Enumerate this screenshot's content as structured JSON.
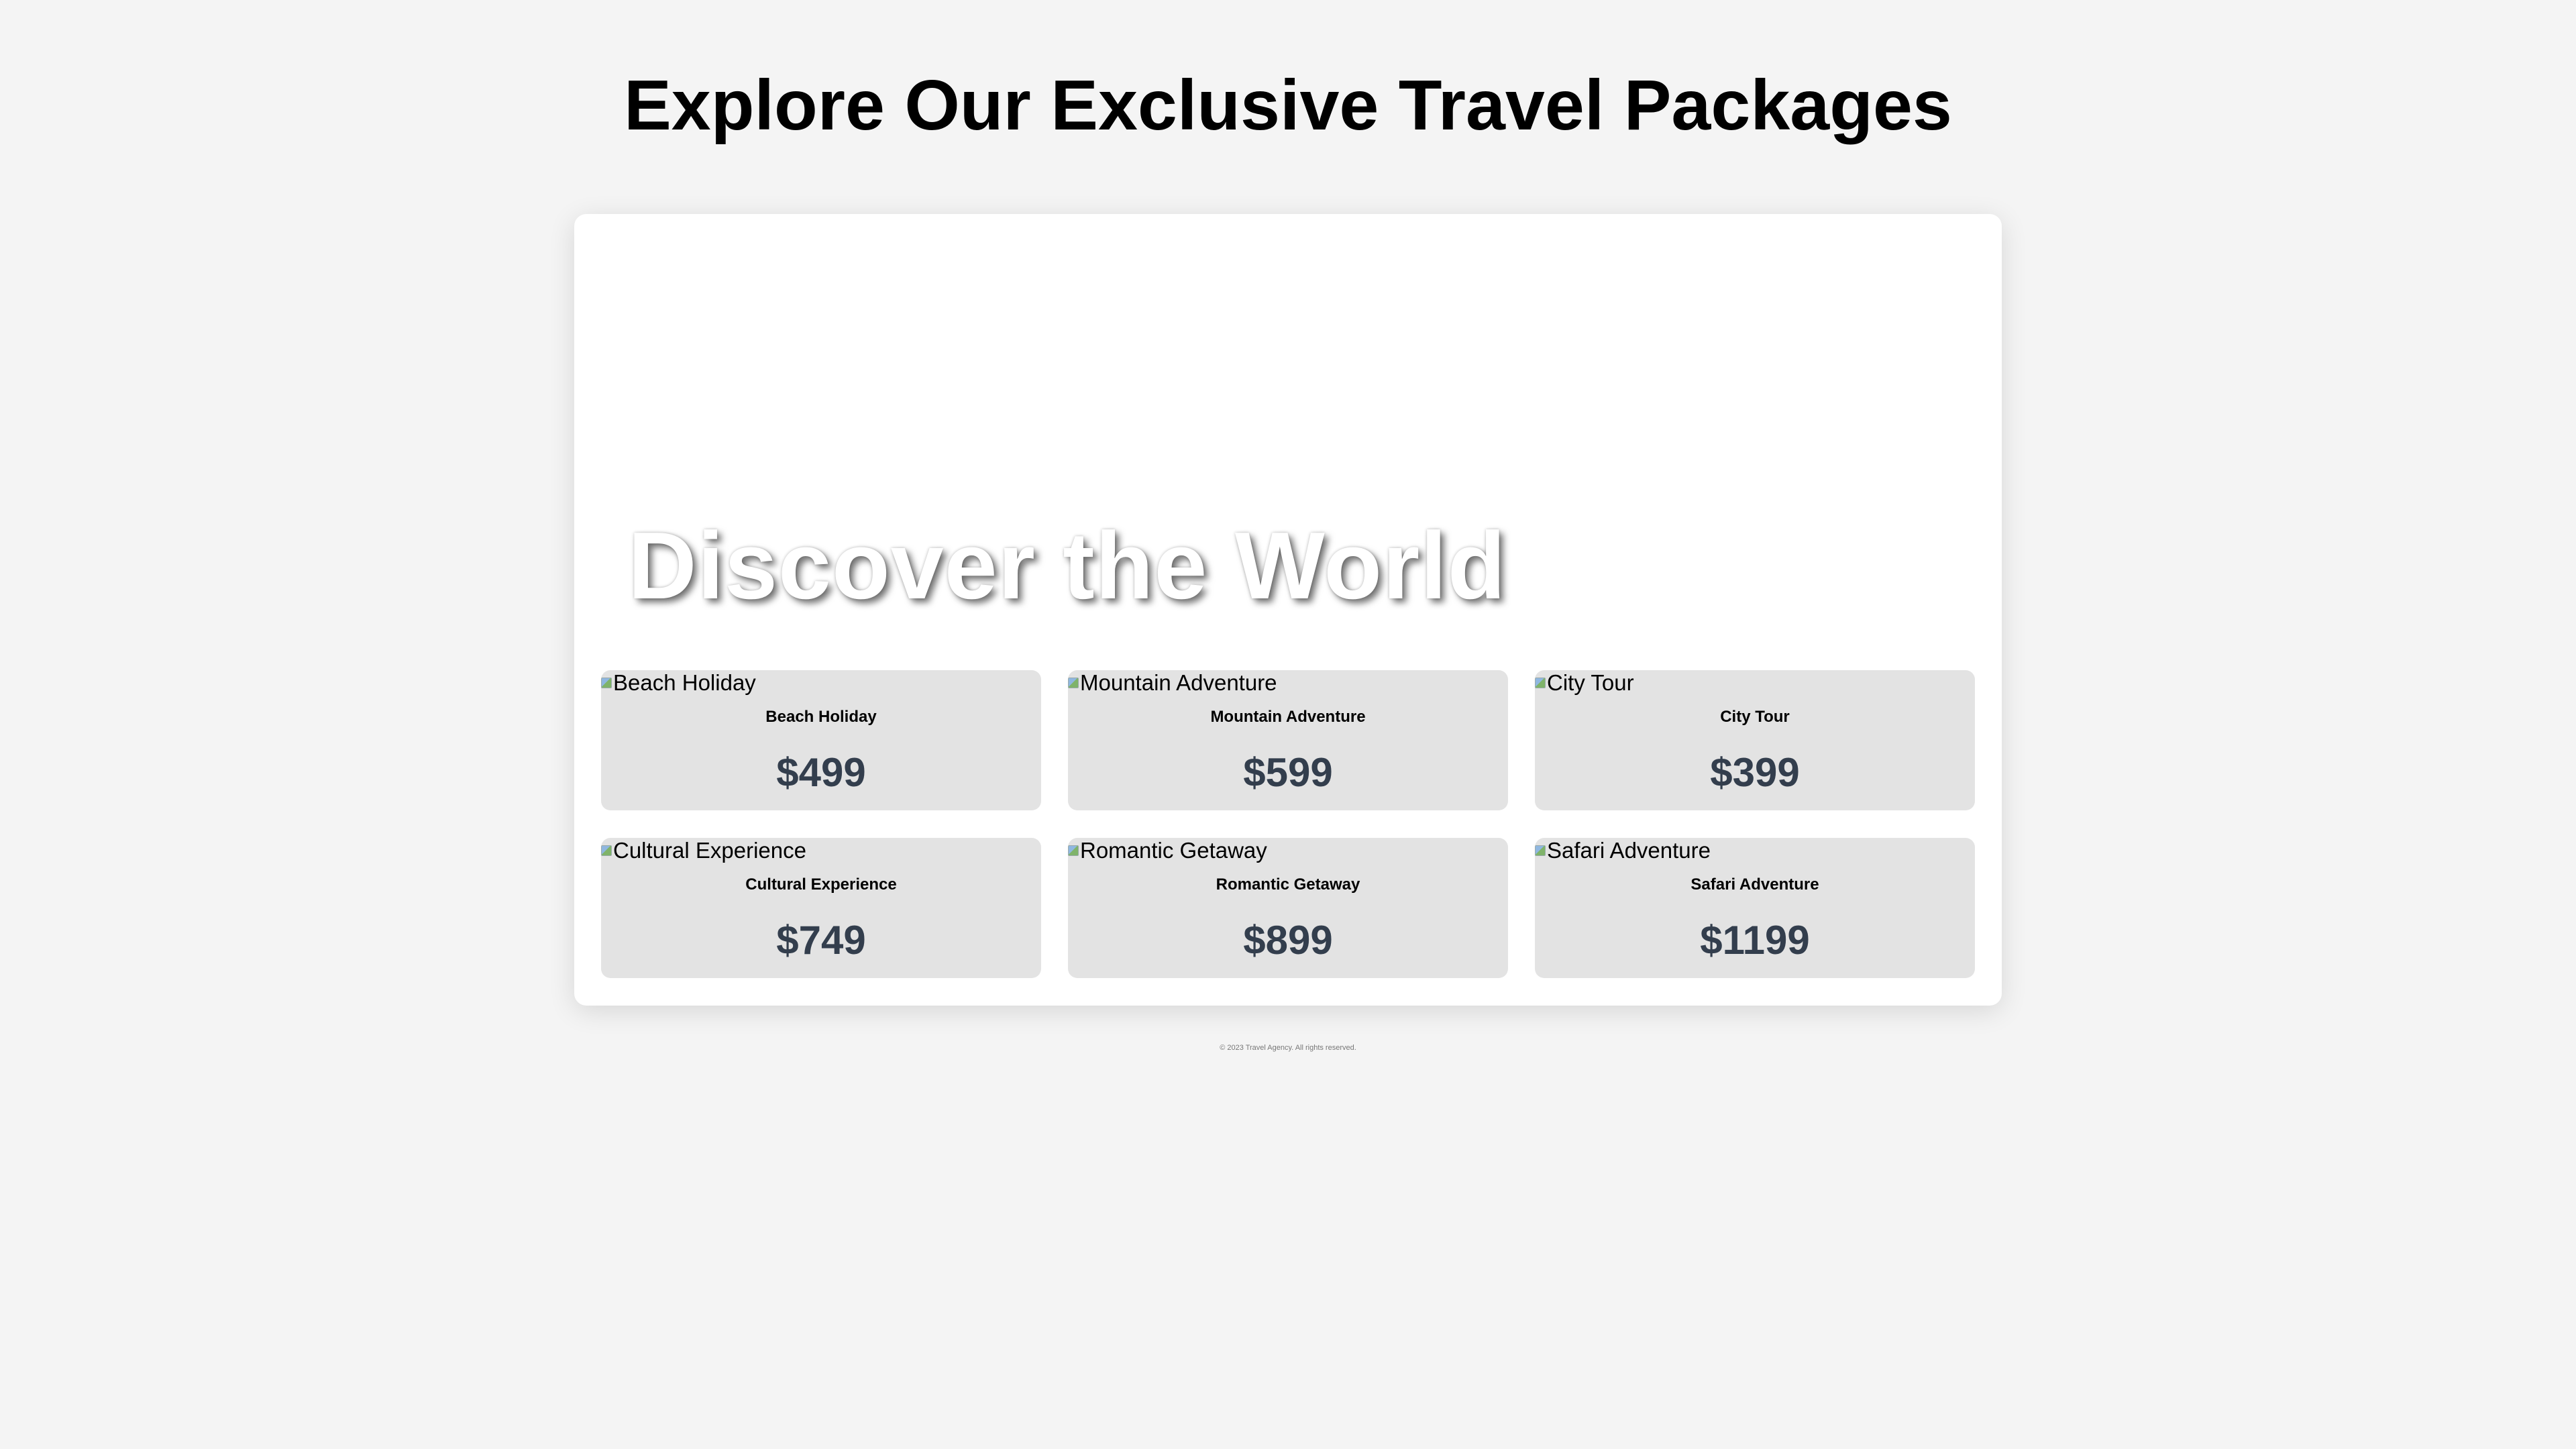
{
  "page": {
    "title": "Explore Our Exclusive Travel Packages"
  },
  "hero": {
    "title": "Discover the World"
  },
  "packages": [
    {
      "image_alt": "Beach Holiday",
      "name": "Beach Holiday",
      "price": "$499"
    },
    {
      "image_alt": "Mountain Adventure",
      "name": "Mountain Adventure",
      "price": "$599"
    },
    {
      "image_alt": "City Tour",
      "name": "City Tour",
      "price": "$399"
    },
    {
      "image_alt": "Cultural Experience",
      "name": "Cultural Experience",
      "price": "$749"
    },
    {
      "image_alt": "Romantic Getaway",
      "name": "Romantic Getaway",
      "price": "$899"
    },
    {
      "image_alt": "Safari Adventure",
      "name": "Safari Adventure",
      "price": "$1199"
    }
  ],
  "footer": {
    "text": "© 2023 Travel Agency. All rights reserved."
  },
  "colors": {
    "background": "#f4f4f4",
    "card_background": "#e3e3e3",
    "price_text": "#333e4d",
    "hero_text": "#ffffff"
  }
}
